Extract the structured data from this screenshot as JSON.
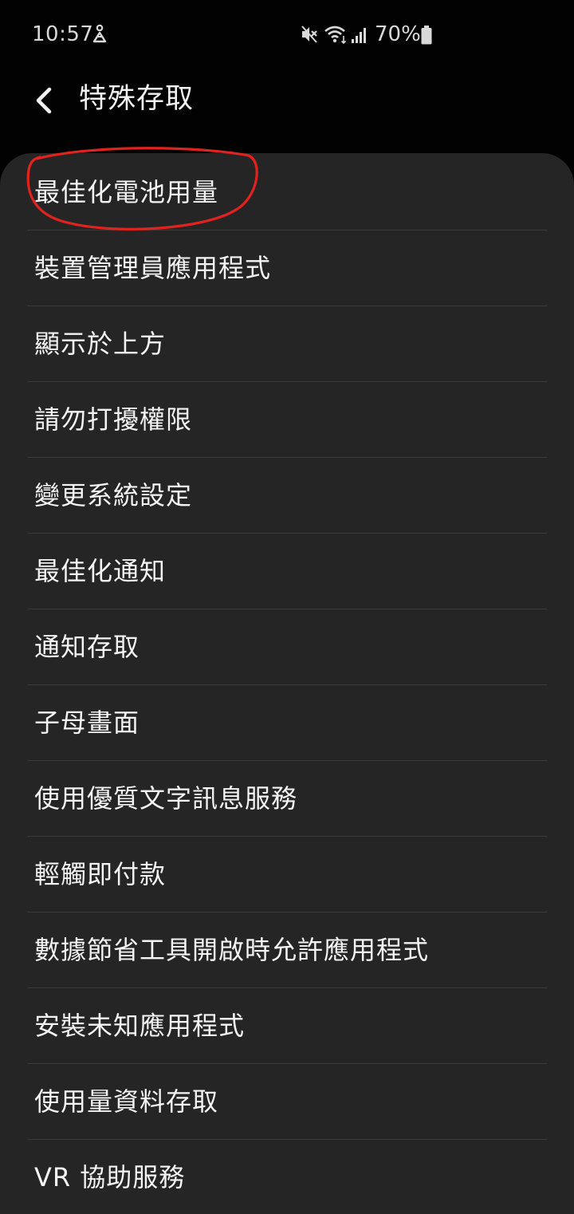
{
  "status_bar": {
    "time": "10:57",
    "battery_percent": "70%",
    "icons": [
      "notification-icon",
      "mute-icon",
      "wifi-icon",
      "signal-icon",
      "battery-icon"
    ]
  },
  "header": {
    "title": "特殊存取",
    "back_icon": "chevron-left-icon"
  },
  "list": {
    "items": [
      {
        "label": "最佳化電池用量"
      },
      {
        "label": "裝置管理員應用程式"
      },
      {
        "label": "顯示於上方"
      },
      {
        "label": "請勿打擾權限"
      },
      {
        "label": "變更系統設定"
      },
      {
        "label": "最佳化通知"
      },
      {
        "label": "通知存取"
      },
      {
        "label": "子母畫面"
      },
      {
        "label": "使用優質文字訊息服務"
      },
      {
        "label": "輕觸即付款"
      },
      {
        "label": "數據節省工具開啟時允許應用程式"
      },
      {
        "label": "安裝未知應用程式"
      },
      {
        "label": "使用量資料存取"
      },
      {
        "label": "VR 協助服務"
      }
    ]
  },
  "colors": {
    "background": "#020202",
    "card": "#252525",
    "divider": "#3c3c3c",
    "text": "#f4f4f4",
    "annotation": "#e0231e"
  }
}
